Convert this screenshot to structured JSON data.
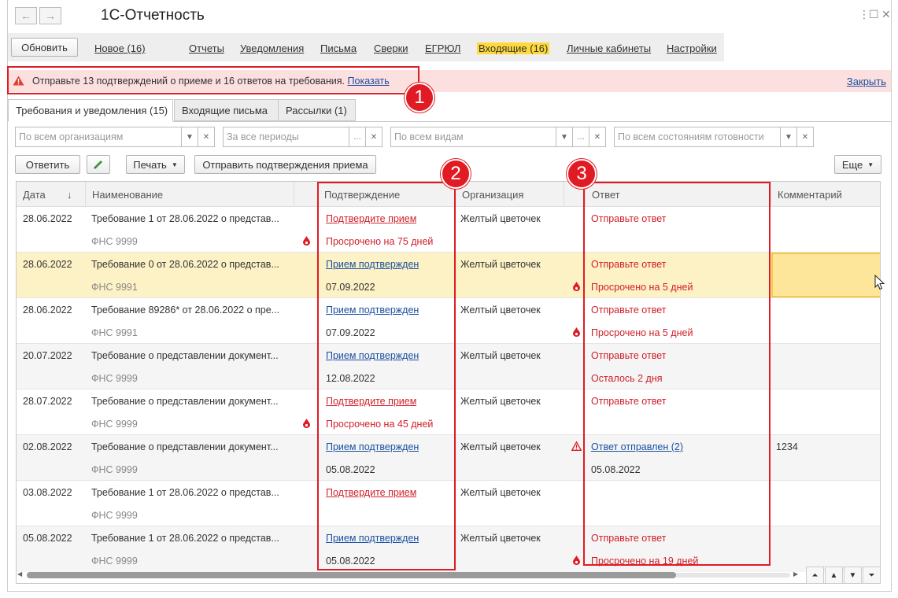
{
  "app": {
    "title": "1С-Отчетность"
  },
  "titlebar": {
    "back_glyph": "←",
    "forward_glyph": "→",
    "more_glyph": "⋮",
    "maximize_glyph": "☐",
    "close_glyph": "✕"
  },
  "toolbar": {
    "refresh_label": "Обновить",
    "menu": [
      {
        "label": "Новое (16)"
      },
      {
        "label": "Отчеты"
      },
      {
        "label": "Уведомления"
      },
      {
        "label": "Письма"
      },
      {
        "label": "Сверки"
      },
      {
        "label": "ЕГРЮЛ"
      },
      {
        "label": "Входящие (16)",
        "active": true
      },
      {
        "label": "Личные кабинеты"
      },
      {
        "label": "Настройки"
      }
    ]
  },
  "warning": {
    "text": "Отправьте 13 подтверждений о приеме и 16 ответов на требования.",
    "show_link": "Показать",
    "close_link": "Закрыть",
    "color": "#fcdfdf"
  },
  "tabs": [
    {
      "label": "Требования и уведомления (15)",
      "active": true
    },
    {
      "label": "Входящие письма"
    },
    {
      "label": "Рассылки (1)"
    }
  ],
  "filters": {
    "organization": "По всем организациям",
    "period": "За все периоды",
    "kind": "По всем видам",
    "state": "По всем состояниям готовности"
  },
  "actions": {
    "reply": "Ответить",
    "print": "Печать",
    "send_confirm": "Отправить подтверждения приема",
    "more": "Еще"
  },
  "grid": {
    "columns": {
      "date": "Дата",
      "sort_glyph": "↓",
      "name": "Наименование",
      "confirm": "Подтверждение",
      "org": "Организация",
      "answer": "Ответ",
      "comment": "Комментарий"
    },
    "rows": [
      {
        "date": "28.06.2022",
        "name": "Требование 1 от 28.06.2022 о представ...",
        "sub": "ФНС 9999",
        "confirm": "Подтвердите прием",
        "confirm_sub": "Просрочено на 75 дней",
        "org": "Желтый цветочек",
        "answer": "Отправьте ответ",
        "answer_sub": "",
        "comment": ""
      },
      {
        "date": "28.06.2022",
        "name": "Требование 0 от 28.06.2022 о представ...",
        "sub": "ФНС 9991",
        "confirm": "Прием подтвержден",
        "confirm_sub": "07.09.2022",
        "org": "Желтый цветочек",
        "answer": "Отправьте ответ",
        "answer_sub": "Просрочено на 5 дней",
        "comment": ""
      },
      {
        "date": "28.06.2022",
        "name": "Требование 89286* от 28.06.2022 о пре...",
        "sub": "ФНС 9991",
        "confirm": "Прием подтвержден",
        "confirm_sub": "07.09.2022",
        "org": "Желтый цветочек",
        "answer": "Отправьте ответ",
        "answer_sub": "Просрочено на 5 дней",
        "comment": ""
      },
      {
        "date": "20.07.2022",
        "name": "Требование о представлении документ...",
        "sub": "ФНС 9999",
        "confirm": "Прием подтвержден",
        "confirm_sub": "12.08.2022",
        "org": "Желтый цветочек",
        "answer": "Отправьте ответ",
        "answer_sub": "Осталось 2 дня",
        "comment": ""
      },
      {
        "date": "28.07.2022",
        "name": "Требование о представлении документ...",
        "sub": "ФНС 9999",
        "confirm": "Подтвердите прием",
        "confirm_sub": "Просрочено на 45 дней",
        "org": "Желтый цветочек",
        "answer": "Отправьте ответ",
        "answer_sub": "",
        "comment": ""
      },
      {
        "date": "02.08.2022",
        "name": "Требование о представлении документ...",
        "sub": "ФНС 9999",
        "confirm": "Прием подтвержден",
        "confirm_sub": "05.08.2022",
        "org": "Желтый цветочек",
        "answer": "Ответ отправлен (2)",
        "answer_sub": "05.08.2022",
        "comment": "1234"
      },
      {
        "date": "03.08.2022",
        "name": "Требование 1 от 28.06.2022 о представ...",
        "sub": "ФНС 9999",
        "confirm": "Подтвердите прием",
        "confirm_sub": "",
        "org": "Желтый цветочек",
        "answer": "",
        "answer_sub": "",
        "comment": ""
      },
      {
        "date": "05.08.2022",
        "name": "Требование 1 от 28.06.2022 о представ...",
        "sub": "ФНС 9999",
        "confirm": "Прием подтвержден",
        "confirm_sub": "05.08.2022",
        "org": "Желтый цветочек",
        "answer": "Отправьте ответ",
        "answer_sub": "Просрочено на 19 дней",
        "comment": ""
      }
    ]
  },
  "annotations": [
    {
      "label": "1"
    },
    {
      "label": "2"
    },
    {
      "label": "3"
    }
  ],
  "colors": {
    "accent_red": "#e01b24",
    "active_menu": "#ffd83a",
    "link_blue": "#1a4fa0",
    "status_red": "#d0202a",
    "selected_row": "#fdf1c6"
  }
}
